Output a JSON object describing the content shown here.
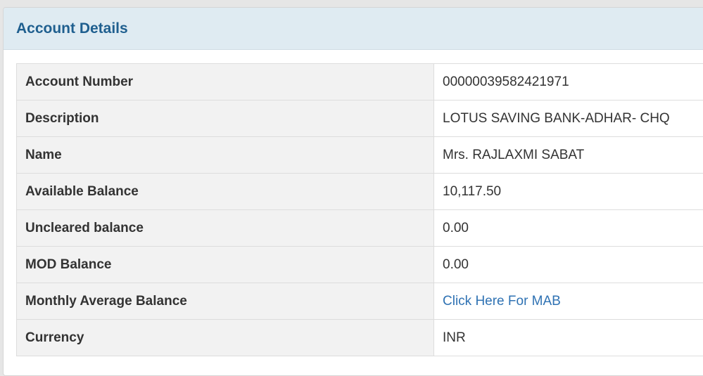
{
  "panel": {
    "title": "Account Details"
  },
  "rows": [
    {
      "label": "Account Number",
      "value": "00000039582421971"
    },
    {
      "label": "Description",
      "value": "LOTUS SAVING BANK-ADHAR- CHQ"
    },
    {
      "label": "Name",
      "value": "Mrs. RAJLAXMI SABAT"
    },
    {
      "label": "Available Balance",
      "value": "10,117.50"
    },
    {
      "label": "Uncleared balance",
      "value": "0.00"
    },
    {
      "label": "MOD Balance",
      "value": "0.00"
    },
    {
      "label": "Monthly Average Balance",
      "link_text": "Click Here For MAB"
    },
    {
      "label": "Currency",
      "value": "INR"
    }
  ],
  "colors": {
    "heading_bg": "#dfebf2",
    "title": "#1f5f8f",
    "link": "#2f72b3",
    "label_bg": "#f2f2f2"
  }
}
